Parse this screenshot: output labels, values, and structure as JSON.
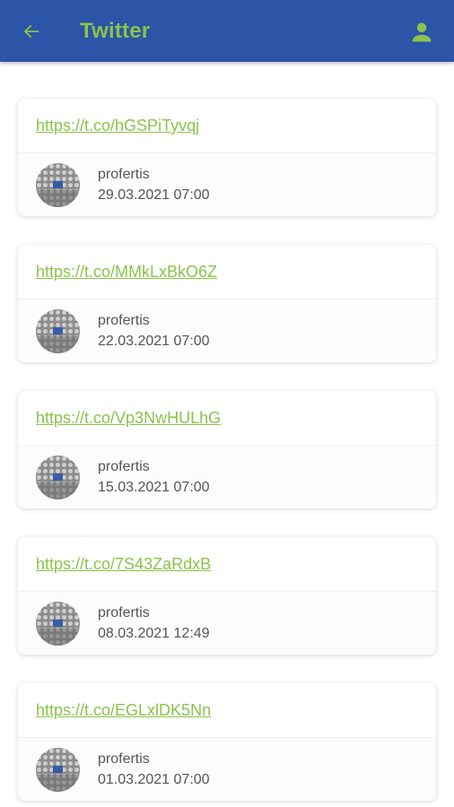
{
  "header": {
    "title": "Twitter",
    "back_icon": "arrow-left-icon",
    "account_icon": "person-icon"
  },
  "posts": [
    {
      "link": "https://t.co/hGSPiTyvqj",
      "author": "profertis",
      "date": "29.03.2021 07:00"
    },
    {
      "link": "https://t.co/MMkLxBkO6Z",
      "author": "profertis",
      "date": "22.03.2021 07:00"
    },
    {
      "link": "https://t.co/Vp3NwHULhG",
      "author": "profertis",
      "date": "15.03.2021 07:00"
    },
    {
      "link": "https://t.co/7S43ZaRdxB",
      "author": "profertis",
      "date": "08.03.2021 12:49"
    },
    {
      "link": "https://t.co/EGLxlDK5Nn",
      "author": "profertis",
      "date": "01.03.2021 07:00"
    }
  ],
  "colors": {
    "appbar": "#2c54a7",
    "accent": "#8bc34a",
    "text": "#555555"
  }
}
